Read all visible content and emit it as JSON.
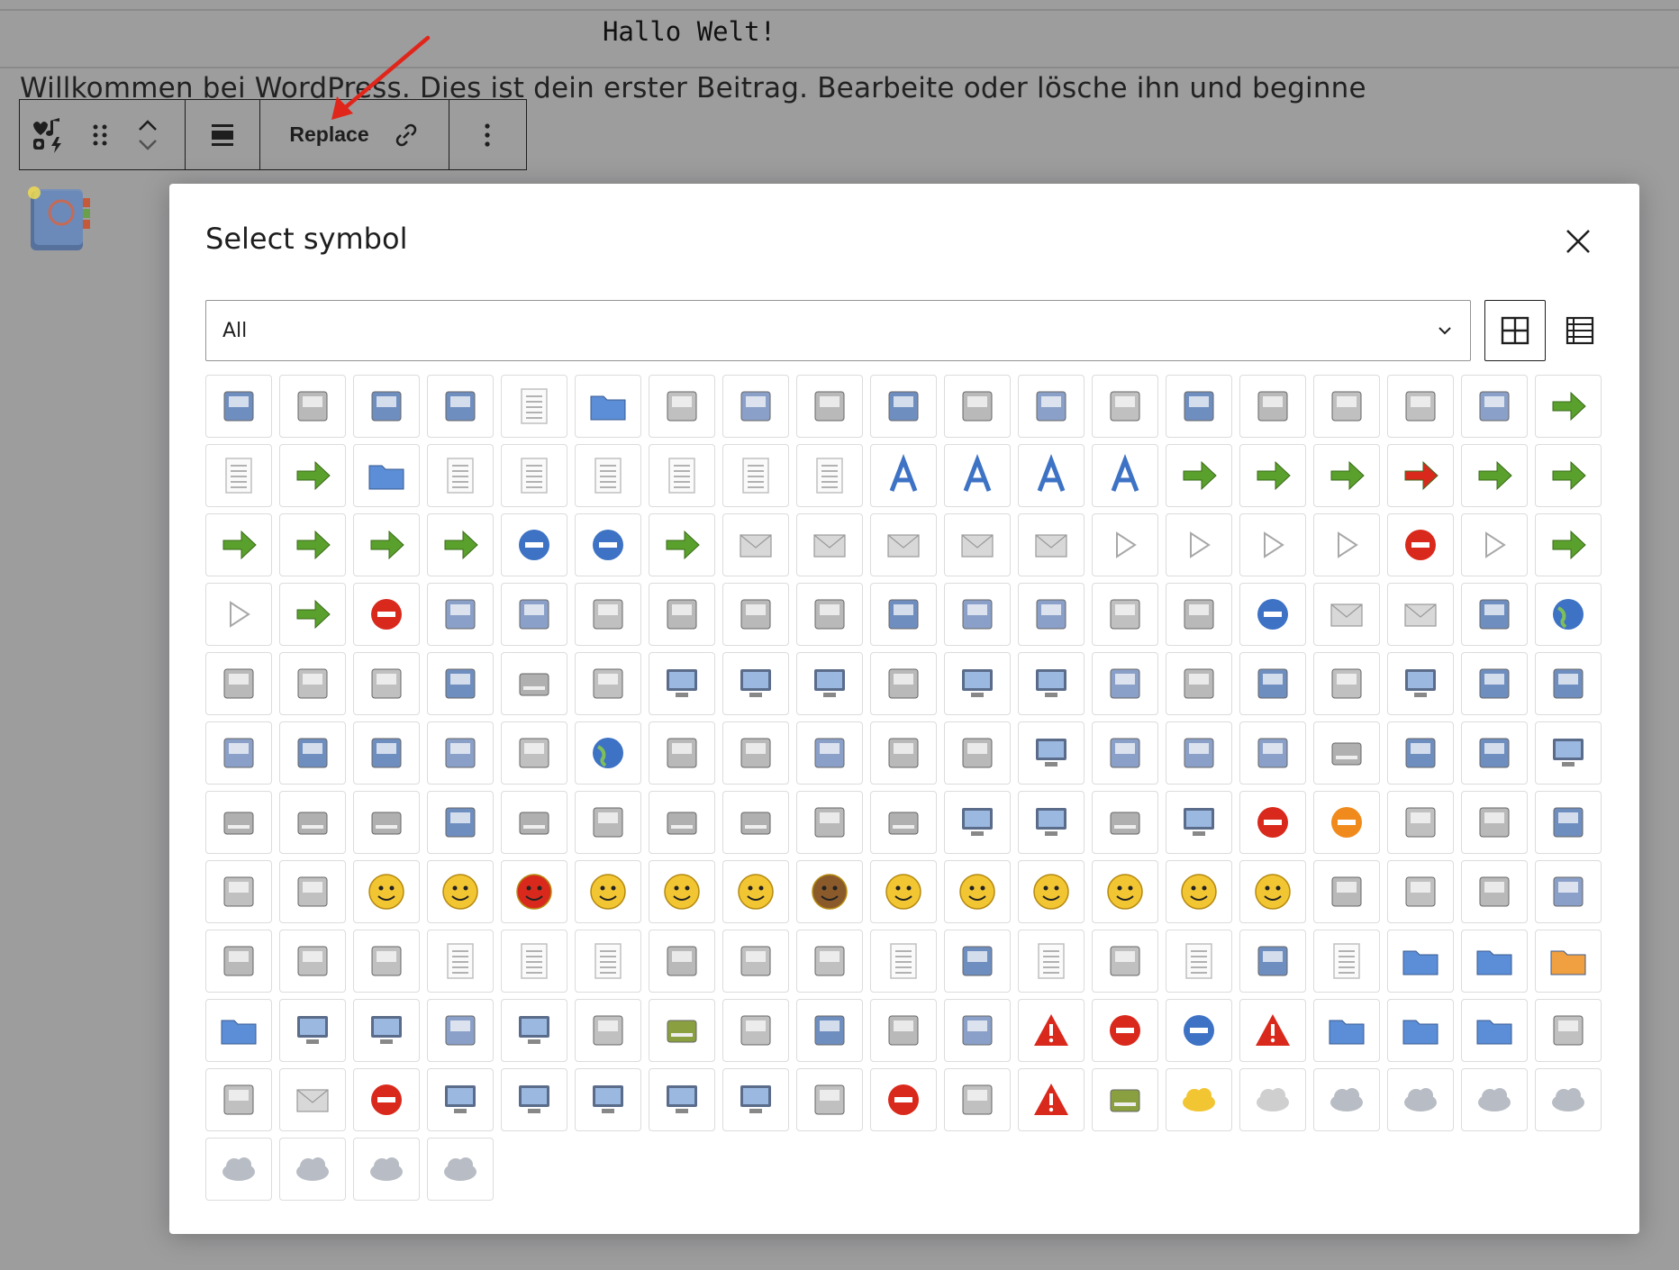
{
  "editor": {
    "post_title": "Hallo Welt!",
    "paragraph": "Willkommen bei WordPress. Dies ist dein erster Beitrag. Bearbeite oder lösche ihn und beginne",
    "toolbar": {
      "block_type_icon": "block-icon-symbol",
      "drag_icon": "drag-handle-icon",
      "move_icon": "move-up-down-icon",
      "align_icon": "align-icon",
      "replace_label": "Replace",
      "link_icon": "link-icon",
      "more_icon": "more-options-icon"
    },
    "selected_block_icon": "address-book-icon",
    "annotation_color": "#e0261b"
  },
  "modal": {
    "title": "Select symbol",
    "close_icon": "close-icon",
    "filter": {
      "value": "All"
    },
    "view_modes": [
      "grid-view",
      "list-view"
    ],
    "active_view": "grid-view",
    "symbols": [
      [
        "address-book",
        "alarm-clock",
        "bookmark-new",
        "contact-card",
        "document-new",
        "folder-open",
        "document-save",
        "document-print-preview",
        "document-properties",
        "document-save-as",
        "document-export",
        "edit-clear",
        "edit-copy",
        "edit-cut",
        "edit-delete",
        "edit-find",
        "edit-find-replace",
        "edit-paste",
        "edit-redo"
      ],
      [
        "edit-select-all",
        "edit-undo",
        "folder-new",
        "format-indent-less",
        "format-indent-more",
        "format-justify-center",
        "format-justify-fill",
        "format-justify-left",
        "format-justify-right",
        "format-text-bold",
        "format-text-italic",
        "format-text-strikethrough",
        "format-text-underline",
        "go-bottom",
        "go-down",
        "go-first",
        "go-home",
        "go-jump",
        "go-last"
      ],
      [
        "go-next",
        "go-previous",
        "go-top",
        "go-up",
        "list-add",
        "list-remove",
        "mail-forward",
        "mail-mark-junk",
        "mail-message-new",
        "mail-reply-all",
        "mail-reply-sender",
        "mail-send-receive",
        "media-eject",
        "media-playback-pause",
        "media-playback-start",
        "media-playback-stop",
        "media-record",
        "media-seek-backward",
        "media-seek-forward"
      ],
      [
        "media-skip-backward",
        "media-skip-forward",
        "process-stop",
        "system-lock-screen",
        "system-log-out",
        "system-search",
        "system-shutdown",
        "tab-new",
        "view-fullscreen",
        "view-refresh",
        "window-new",
        "accessories-calculator",
        "accessories-character-map",
        "accessories-text-editor",
        "help-browser",
        "internet-group-chat",
        "internet-mail",
        "internet-news-reader",
        "internet-web-browser"
      ],
      [
        "office-calendar",
        "preferences-accessibility",
        "preferences-assistive",
        "preferences-font",
        "preferences-keyboard-shortcuts",
        "preferences-theme",
        "preferences-remote-desktop",
        "preferences-network",
        "preferences-screensaver",
        "preferences-session",
        "preferences-display",
        "preferences-system-network",
        "preferences-server",
        "preferences-windows",
        "file-cabinet",
        "media-optical",
        "network-globe",
        "system-users",
        "utilities-system-monitor"
      ],
      [
        "utilities-terminal",
        "applications-accessories",
        "applications-development",
        "applications-games",
        "applications-graphics",
        "applications-internet",
        "applications-multimedia",
        "applications-office",
        "applications-other",
        "applications-system",
        "system-file-manager",
        "preferences-desktop-peripherals",
        "applications-utilities",
        "audio-card",
        "audio-input-microphone",
        "battery",
        "camera-photo",
        "camera-video",
        "computer"
      ],
      [
        "drive-harddisk",
        "drive-optical",
        "drive-removable-media",
        "input-gaming",
        "input-keyboard",
        "input-mouse",
        "media-flash",
        "media-floppy",
        "media-cdrom",
        "modem",
        "network-wired",
        "network-wireless",
        "printer",
        "video-display",
        "emblem-favorite",
        "dialog-important",
        "emblem-photos",
        "emblem-readonly",
        "emblem-symbolic-link"
      ],
      [
        "emblem-system",
        "emblem-unreadable",
        "face-angel",
        "face-crying",
        "face-devilish",
        "face-glasses",
        "face-grin",
        "face-kiss",
        "face-monkey",
        "face-plain",
        "face-sad",
        "face-smile-big",
        "face-smile",
        "face-surprise",
        "face-wink",
        "application-certificate",
        "x-office-document",
        "audio-x-generic",
        "font-x-generic"
      ],
      [
        "image-x-generic",
        "package-x-generic",
        "text-html",
        "text-x-generic",
        "text-x-generic-template",
        "text-x-script",
        "video-x-generic",
        "x-office-address-book",
        "x-office-calendar",
        "x-office-document-template",
        "x-office-drawing",
        "x-office-drawing-template",
        "x-office-presentation",
        "x-office-presentation-template",
        "x-office-spreadsheet",
        "x-office-spreadsheet-template",
        "folder",
        "folder-remote",
        "folder-search"
      ],
      [
        "folder-saved-search",
        "network-server",
        "network-workgroup",
        "start-here",
        "user-desktop",
        "user-home",
        "user-trash",
        "audio-volume-high",
        "audio-volume-low",
        "audio-volume-medium",
        "audio-volume-muted",
        "battery-caution",
        "dialog-error",
        "dialog-information",
        "dialog-warning",
        "folder-drag-accept",
        "folder-open-2",
        "folder-visiting",
        "image-loading"
      ],
      [
        "image-missing",
        "mail-attachment",
        "network-error",
        "network-idle",
        "network-offline",
        "network-receive",
        "network-transmit",
        "network-transmit-receive",
        "security-high",
        "printer-error",
        "software-update-available",
        "software-update-urgent",
        "user-trash-full",
        "weather-clear",
        "weather-clear-night",
        "weather-few-clouds",
        "weather-few-clouds-night",
        "weather-overcast",
        "weather-severe-alert"
      ],
      [
        "weather-showers",
        "weather-showers-scattered",
        "weather-snow",
        "weather-storm"
      ]
    ]
  }
}
